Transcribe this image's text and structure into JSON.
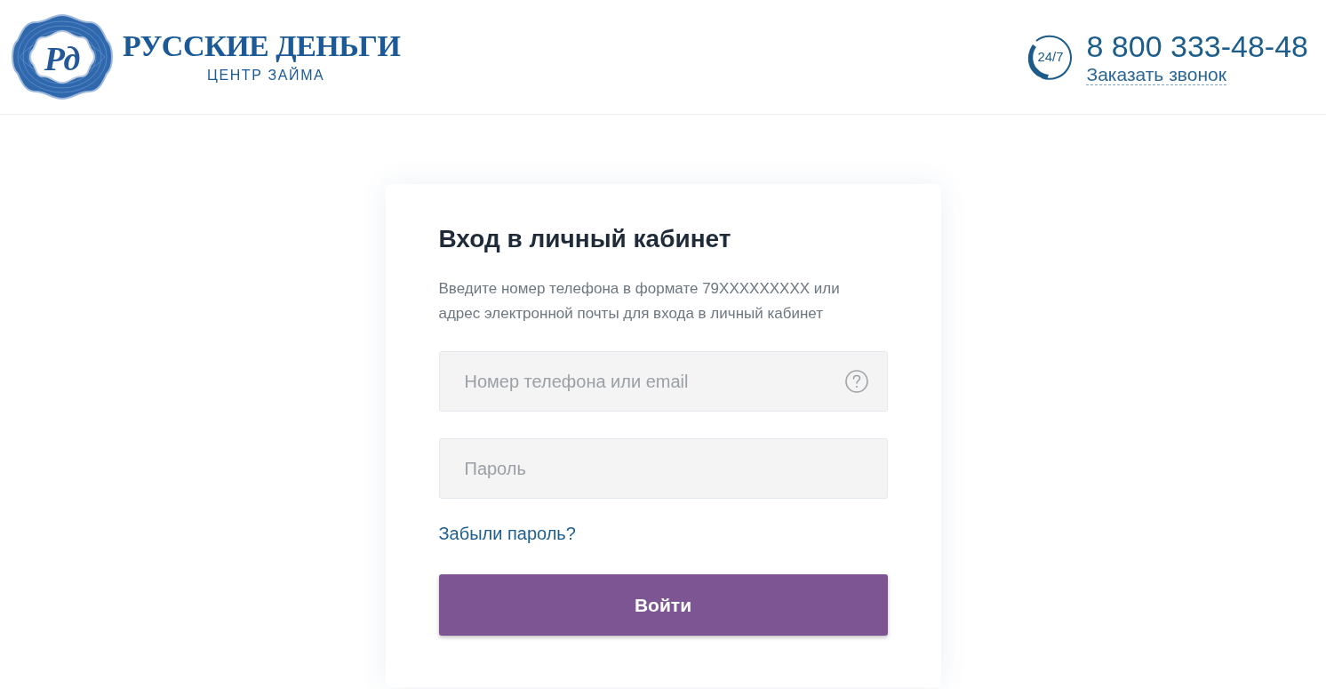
{
  "header": {
    "logo": {
      "monogram": "Рд",
      "name": "РУССКИЕ ДЕНЬГИ",
      "tagline": "ЦЕНТР ЗАЙМА"
    },
    "contact": {
      "badge": "24/7",
      "phone": "8 800 333-48-48",
      "callback_link": "Заказать звонок"
    }
  },
  "login_card": {
    "title": "Вход в личный кабинет",
    "description": "Введите номер телефона в формате 79XXXXXXXXX или адрес электронной почты для входа в личный кабинет",
    "fields": [
      {
        "placeholder": "Номер телефона или email",
        "help": true
      },
      {
        "placeholder": "Пароль",
        "help": false
      }
    ],
    "forgot_link": "Забыли пароль?",
    "submit_button": "Войти"
  }
}
